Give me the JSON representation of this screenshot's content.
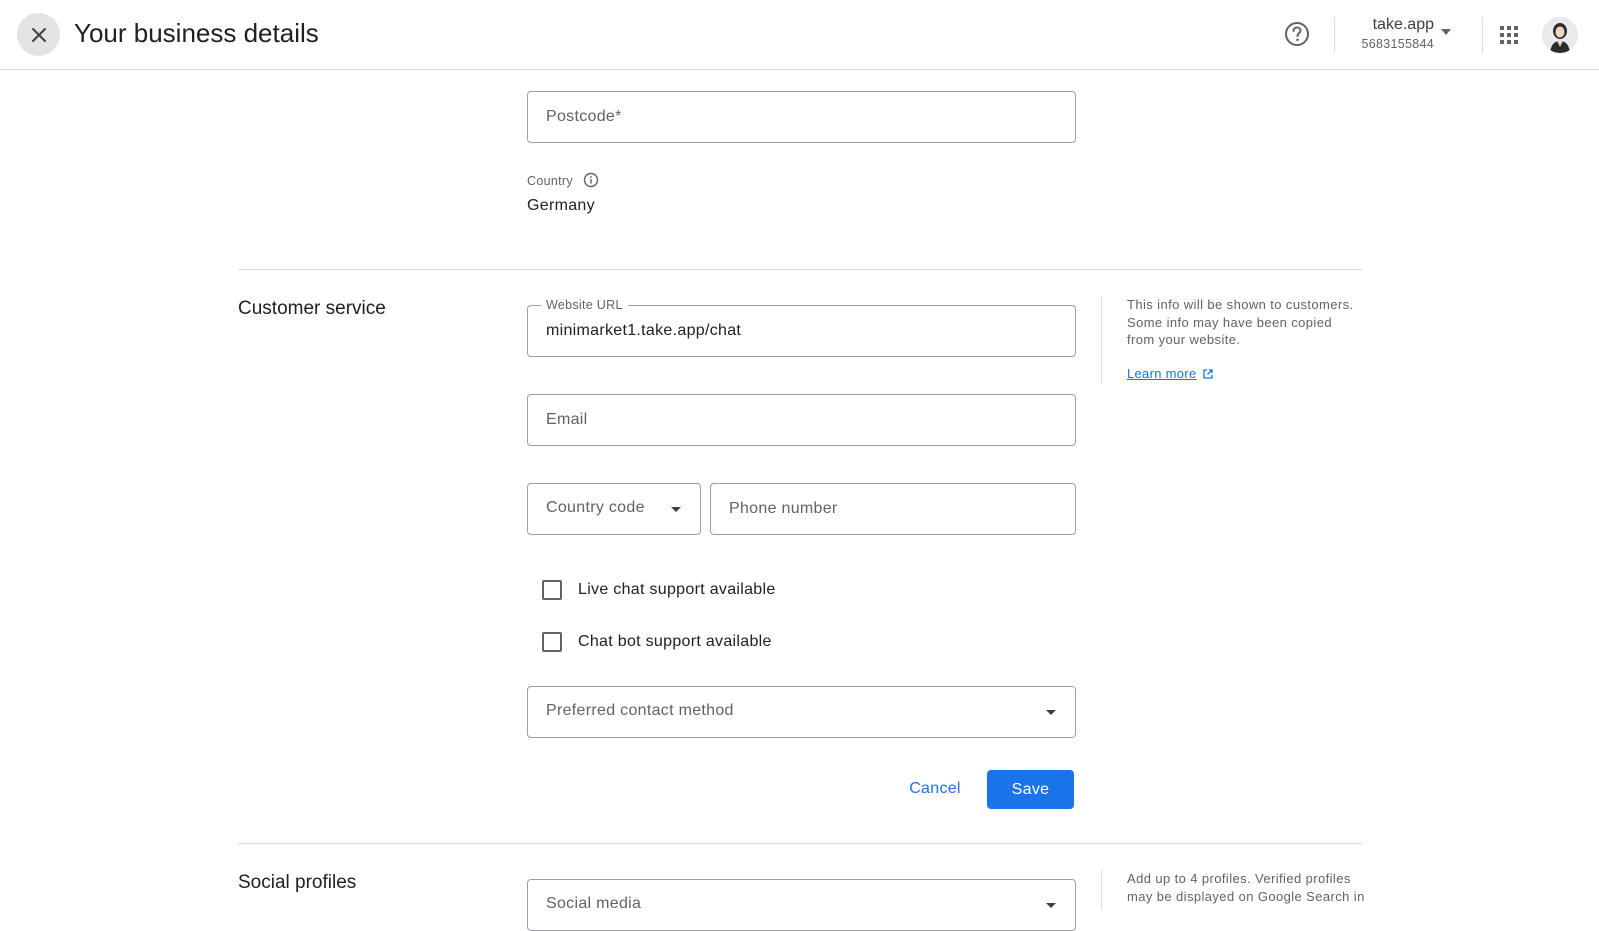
{
  "header": {
    "title": "Your business details",
    "account_name": "take.app",
    "account_id": "5683155844"
  },
  "address": {
    "postcode_placeholder": "Postcode*",
    "country_label": "Country",
    "country_value": "Germany"
  },
  "customer_service": {
    "title": "Customer service",
    "website_label": "Website URL",
    "website_value": "minimarket1.take.app/chat",
    "email_placeholder": "Email",
    "country_code_placeholder": "Country code",
    "phone_placeholder": "Phone number",
    "live_chat_label": "Live chat support available",
    "chat_bot_label": "Chat bot support available",
    "preferred_contact_placeholder": "Preferred contact method",
    "side_note": "This info will be shown to customers. Some info may have been copied from your website.",
    "learn_more": "Learn more",
    "cancel_label": "Cancel",
    "save_label": "Save"
  },
  "social_profiles": {
    "title": "Social profiles",
    "social_media_placeholder": "Social media",
    "side_note": "Add up to 4 profiles. Verified profiles may be displayed on Google Search in"
  },
  "colors": {
    "accent": "#1a73e8",
    "border": "#9aa0a6",
    "divider": "#dadce0",
    "muted_text": "#5f6368"
  }
}
